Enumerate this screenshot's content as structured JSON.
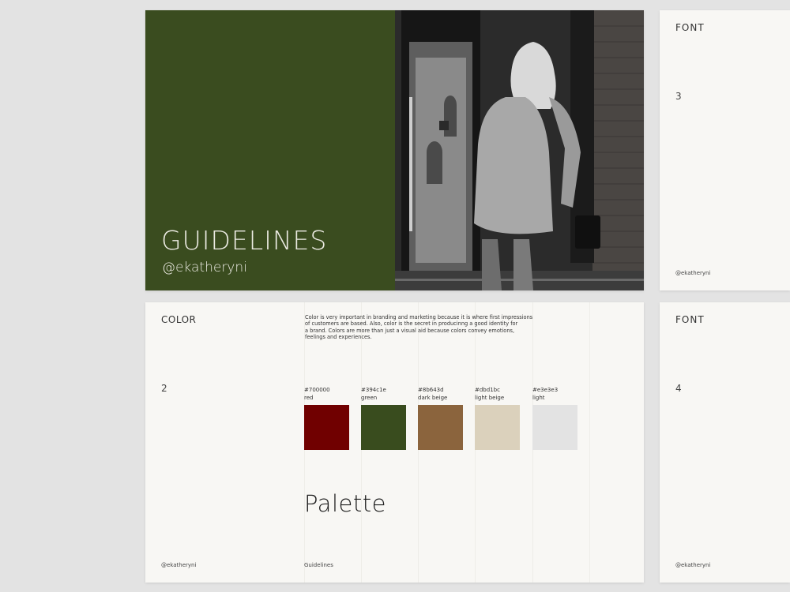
{
  "cover": {
    "title": "GUIDELINES",
    "handle": "@ekatheryni",
    "background": "#394c1e"
  },
  "font_slide_3": {
    "label": "FONT",
    "number": "3",
    "footer": "@ekatheryni"
  },
  "font_slide_4": {
    "label": "FONT",
    "number": "4",
    "footer": "@ekatheryni"
  },
  "color_slide": {
    "label": "COLOR",
    "number": "2",
    "description": [
      "Color  is very important in branding and marketing because it is where first impressions of customers are based. Also, color is the secret in producinng a good identity for",
      "a brand. Colors are more than just a visual aid because colors convey emotions, feelings and experiences."
    ],
    "swatches": [
      {
        "hex": "#700000",
        "name": "red",
        "color": "#700000"
      },
      {
        "hex": "#394c1e",
        "name": "green",
        "color": "#394c1e"
      },
      {
        "hex": "#8b643d",
        "name": "dark beige",
        "color": "#8b643d"
      },
      {
        "hex": "#dbd1bc",
        "name": "light beige",
        "color": "#dbd1bc"
      },
      {
        "hex": "#e3e3e3",
        "name": "light",
        "color": "#e3e3e3"
      }
    ],
    "palette_title": "Palette",
    "footer_left": "@ekatheryni",
    "footer_mid": "Guidelines"
  }
}
